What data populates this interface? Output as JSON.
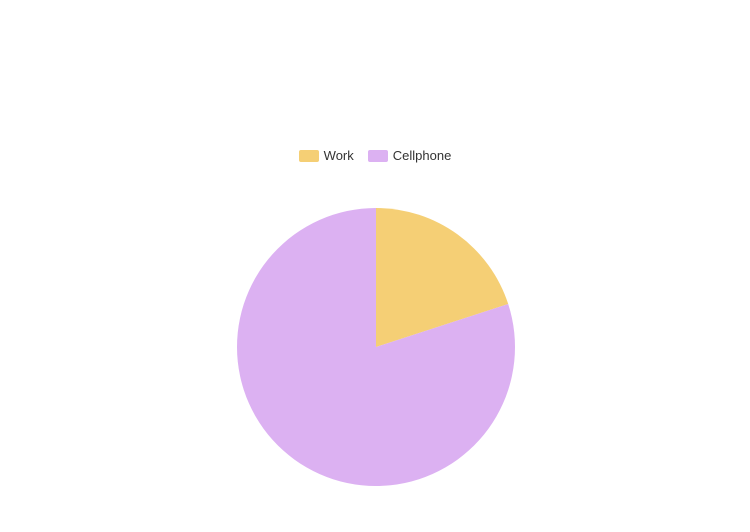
{
  "chart_data": {
    "type": "pie",
    "title": "",
    "legend_position": "top",
    "slices": [
      {
        "label": "Work",
        "value": 20,
        "color": "#f5cf75"
      },
      {
        "label": "Cellphone",
        "value": 80,
        "color": "#dcb1f2"
      }
    ]
  }
}
